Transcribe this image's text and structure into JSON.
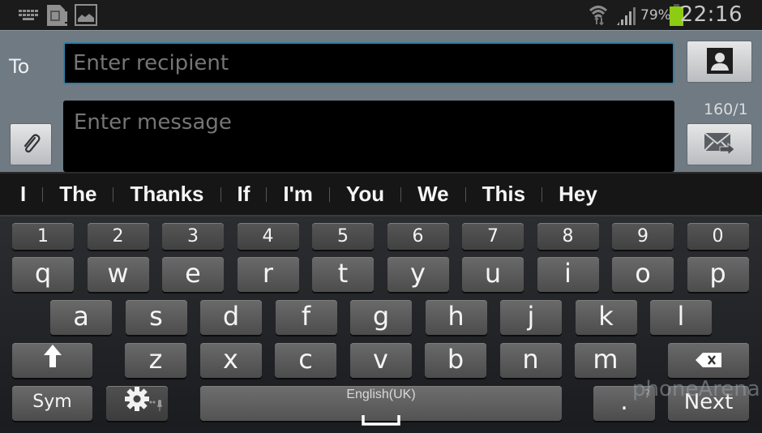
{
  "status_bar": {
    "left_icons": [
      "keyboard-icon",
      "sim-card-alert-icon",
      "image-icon"
    ],
    "right_icons": [
      "wifi-icon",
      "signal-icon",
      "battery-icon"
    ],
    "battery_percent": "79%",
    "battery_level": 0.79,
    "battery_color": "#8ccc12",
    "time": "22:16"
  },
  "compose": {
    "to_label": "To",
    "recipient_placeholder": "Enter recipient",
    "recipient_value": "",
    "message_placeholder": "Enter message",
    "message_value": "",
    "char_counter": "160/1",
    "contact_button_icon": "contact-icon",
    "attach_button_icon": "paperclip-icon",
    "send_button_icon": "send-message-icon"
  },
  "suggestions": [
    "I",
    "The",
    "Thanks",
    "If",
    "I'm",
    "You",
    "We",
    "This",
    "Hey"
  ],
  "keyboard": {
    "number_row": [
      "1",
      "2",
      "3",
      "4",
      "5",
      "6",
      "7",
      "8",
      "9",
      "0"
    ],
    "row1": [
      "q",
      "w",
      "e",
      "r",
      "t",
      "y",
      "u",
      "i",
      "o",
      "p"
    ],
    "row2": [
      "a",
      "s",
      "d",
      "f",
      "g",
      "h",
      "j",
      "k",
      "l"
    ],
    "row3": [
      "z",
      "x",
      "c",
      "v",
      "b",
      "n",
      "m"
    ],
    "sym_label": "Sym",
    "space_label": "English(UK)",
    "period_label": ".",
    "period_hint": "?",
    "next_label": "Next"
  },
  "watermark": "phoneArena"
}
